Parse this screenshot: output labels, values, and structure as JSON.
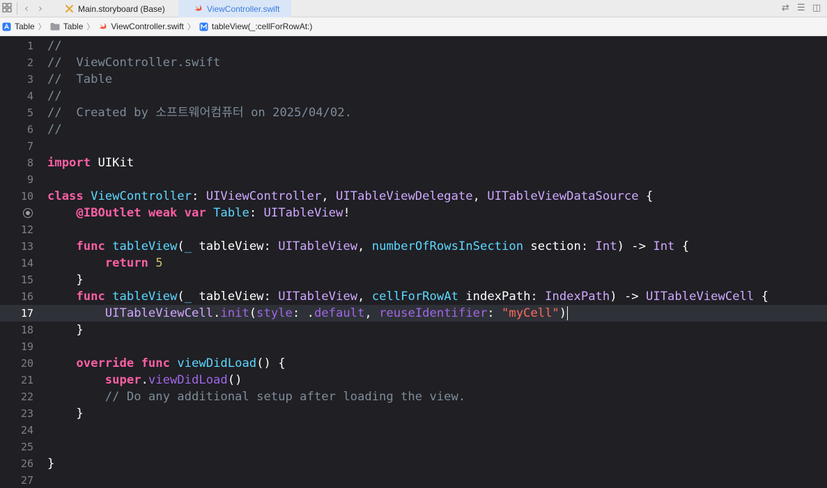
{
  "tabs": [
    {
      "label": "Main.storyboard (Base)",
      "icon": "storyboard-icon",
      "active": false
    },
    {
      "label": "ViewController.swift",
      "icon": "swift-file-icon",
      "active": true
    }
  ],
  "breadcrumb": [
    {
      "label": "Table",
      "icon": "app-project-icon"
    },
    {
      "label": "Table",
      "icon": "folder-icon"
    },
    {
      "label": "ViewController.swift",
      "icon": "swift-file-icon"
    },
    {
      "label": "tableView(_:cellForRowAt:)",
      "icon": "method-icon"
    }
  ],
  "editor": {
    "current_line": 17,
    "breakpoint_line": 11,
    "lines": [
      {
        "n": "1",
        "tokens": [
          {
            "t": "//",
            "c": "comment"
          }
        ]
      },
      {
        "n": "2",
        "tokens": [
          {
            "t": "//  ViewController.swift",
            "c": "comment"
          }
        ]
      },
      {
        "n": "3",
        "tokens": [
          {
            "t": "//  Table",
            "c": "comment"
          }
        ]
      },
      {
        "n": "4",
        "tokens": [
          {
            "t": "//",
            "c": "comment"
          }
        ]
      },
      {
        "n": "5",
        "tokens": [
          {
            "t": "//  Created by 소프트웨어컴퓨터 on 2025/04/02.",
            "c": "comment"
          }
        ]
      },
      {
        "n": "6",
        "tokens": [
          {
            "t": "//",
            "c": "comment"
          }
        ]
      },
      {
        "n": "7",
        "tokens": []
      },
      {
        "n": "8",
        "tokens": [
          {
            "t": "import",
            "c": "kw"
          },
          {
            "t": " UIKit",
            "c": "plain"
          }
        ]
      },
      {
        "n": "9",
        "tokens": []
      },
      {
        "n": "10",
        "tokens": [
          {
            "t": "class",
            "c": "kw"
          },
          {
            "t": " ",
            "c": "plain"
          },
          {
            "t": "ViewController",
            "c": "decl"
          },
          {
            "t": ": ",
            "c": "plain"
          },
          {
            "t": "UIViewController",
            "c": "type"
          },
          {
            "t": ", ",
            "c": "plain"
          },
          {
            "t": "UITableViewDelegate",
            "c": "type"
          },
          {
            "t": ", ",
            "c": "plain"
          },
          {
            "t": "UITableViewDataSource",
            "c": "type"
          },
          {
            "t": " {",
            "c": "plain"
          }
        ]
      },
      {
        "n": "",
        "tokens": [
          {
            "t": "    ",
            "c": "plain"
          },
          {
            "t": "@IBOutlet",
            "c": "kw"
          },
          {
            "t": " ",
            "c": "plain"
          },
          {
            "t": "weak",
            "c": "kw"
          },
          {
            "t": " ",
            "c": "plain"
          },
          {
            "t": "var",
            "c": "kw"
          },
          {
            "t": " ",
            "c": "plain"
          },
          {
            "t": "Table",
            "c": "decl"
          },
          {
            "t": ": ",
            "c": "plain"
          },
          {
            "t": "UITableView",
            "c": "type"
          },
          {
            "t": "!",
            "c": "plain"
          }
        ]
      },
      {
        "n": "12",
        "tokens": []
      },
      {
        "n": "13",
        "tokens": [
          {
            "t": "    ",
            "c": "plain"
          },
          {
            "t": "func",
            "c": "kw"
          },
          {
            "t": " ",
            "c": "plain"
          },
          {
            "t": "tableView",
            "c": "decl"
          },
          {
            "t": "(",
            "c": "plain"
          },
          {
            "t": "_",
            "c": "decl"
          },
          {
            "t": " tableView: ",
            "c": "plain"
          },
          {
            "t": "UITableView",
            "c": "type"
          },
          {
            "t": ", ",
            "c": "plain"
          },
          {
            "t": "numberOfRowsInSection",
            "c": "decl"
          },
          {
            "t": " section: ",
            "c": "plain"
          },
          {
            "t": "Int",
            "c": "type"
          },
          {
            "t": ") -> ",
            "c": "plain"
          },
          {
            "t": "Int",
            "c": "type"
          },
          {
            "t": " {",
            "c": "plain"
          }
        ]
      },
      {
        "n": "14",
        "tokens": [
          {
            "t": "        ",
            "c": "plain"
          },
          {
            "t": "return",
            "c": "kw"
          },
          {
            "t": " ",
            "c": "plain"
          },
          {
            "t": "5",
            "c": "num"
          }
        ]
      },
      {
        "n": "15",
        "tokens": [
          {
            "t": "    }",
            "c": "plain"
          }
        ]
      },
      {
        "n": "16",
        "tokens": [
          {
            "t": "    ",
            "c": "plain"
          },
          {
            "t": "func",
            "c": "kw"
          },
          {
            "t": " ",
            "c": "plain"
          },
          {
            "t": "tableView",
            "c": "decl"
          },
          {
            "t": "(",
            "c": "plain"
          },
          {
            "t": "_",
            "c": "decl"
          },
          {
            "t": " tableView: ",
            "c": "plain"
          },
          {
            "t": "UITableView",
            "c": "type"
          },
          {
            "t": ", ",
            "c": "plain"
          },
          {
            "t": "cellForRowAt",
            "c": "decl"
          },
          {
            "t": " indexPath: ",
            "c": "plain"
          },
          {
            "t": "IndexPath",
            "c": "type"
          },
          {
            "t": ") -> ",
            "c": "plain"
          },
          {
            "t": "UITableViewCell",
            "c": "type"
          },
          {
            "t": " {",
            "c": "plain"
          }
        ]
      },
      {
        "n": "17",
        "tokens": [
          {
            "t": "        ",
            "c": "plain"
          },
          {
            "t": "UITableViewCell",
            "c": "type"
          },
          {
            "t": ".",
            "c": "plain"
          },
          {
            "t": "init",
            "c": "func"
          },
          {
            "t": "(",
            "c": "plain"
          },
          {
            "t": "style",
            "c": "func"
          },
          {
            "t": ": .",
            "c": "plain"
          },
          {
            "t": "default",
            "c": "func"
          },
          {
            "t": ", ",
            "c": "plain"
          },
          {
            "t": "reuseIdentifier",
            "c": "func"
          },
          {
            "t": ": ",
            "c": "plain"
          },
          {
            "t": "\"myCell\"",
            "c": "str"
          },
          {
            "t": ")",
            "c": "plain"
          }
        ]
      },
      {
        "n": "18",
        "tokens": [
          {
            "t": "    }",
            "c": "plain"
          }
        ]
      },
      {
        "n": "19",
        "tokens": []
      },
      {
        "n": "20",
        "tokens": [
          {
            "t": "    ",
            "c": "plain"
          },
          {
            "t": "override",
            "c": "kw"
          },
          {
            "t": " ",
            "c": "plain"
          },
          {
            "t": "func",
            "c": "kw"
          },
          {
            "t": " ",
            "c": "plain"
          },
          {
            "t": "viewDidLoad",
            "c": "decl"
          },
          {
            "t": "() {",
            "c": "plain"
          }
        ]
      },
      {
        "n": "21",
        "tokens": [
          {
            "t": "        ",
            "c": "plain"
          },
          {
            "t": "super",
            "c": "kw"
          },
          {
            "t": ".",
            "c": "plain"
          },
          {
            "t": "viewDidLoad",
            "c": "func"
          },
          {
            "t": "()",
            "c": "plain"
          }
        ]
      },
      {
        "n": "22",
        "tokens": [
          {
            "t": "        ",
            "c": "plain"
          },
          {
            "t": "// Do any additional setup after loading the view.",
            "c": "comment"
          }
        ]
      },
      {
        "n": "23",
        "tokens": [
          {
            "t": "    }",
            "c": "plain"
          }
        ]
      },
      {
        "n": "24",
        "tokens": []
      },
      {
        "n": "25",
        "tokens": []
      },
      {
        "n": "26",
        "tokens": [
          {
            "t": "}",
            "c": "plain"
          }
        ]
      },
      {
        "n": "27",
        "tokens": []
      }
    ]
  },
  "colors": {
    "editor_bg": "#1f1f24",
    "current_line_bg": "#2f3138",
    "keyword": "#fc5fa3",
    "declaration": "#5dd8ff",
    "type": "#d0a8ff",
    "number": "#d0bf69",
    "string": "#fc6a5d",
    "comment": "#7f8c98",
    "active_tab_text": "#3b7de0"
  }
}
